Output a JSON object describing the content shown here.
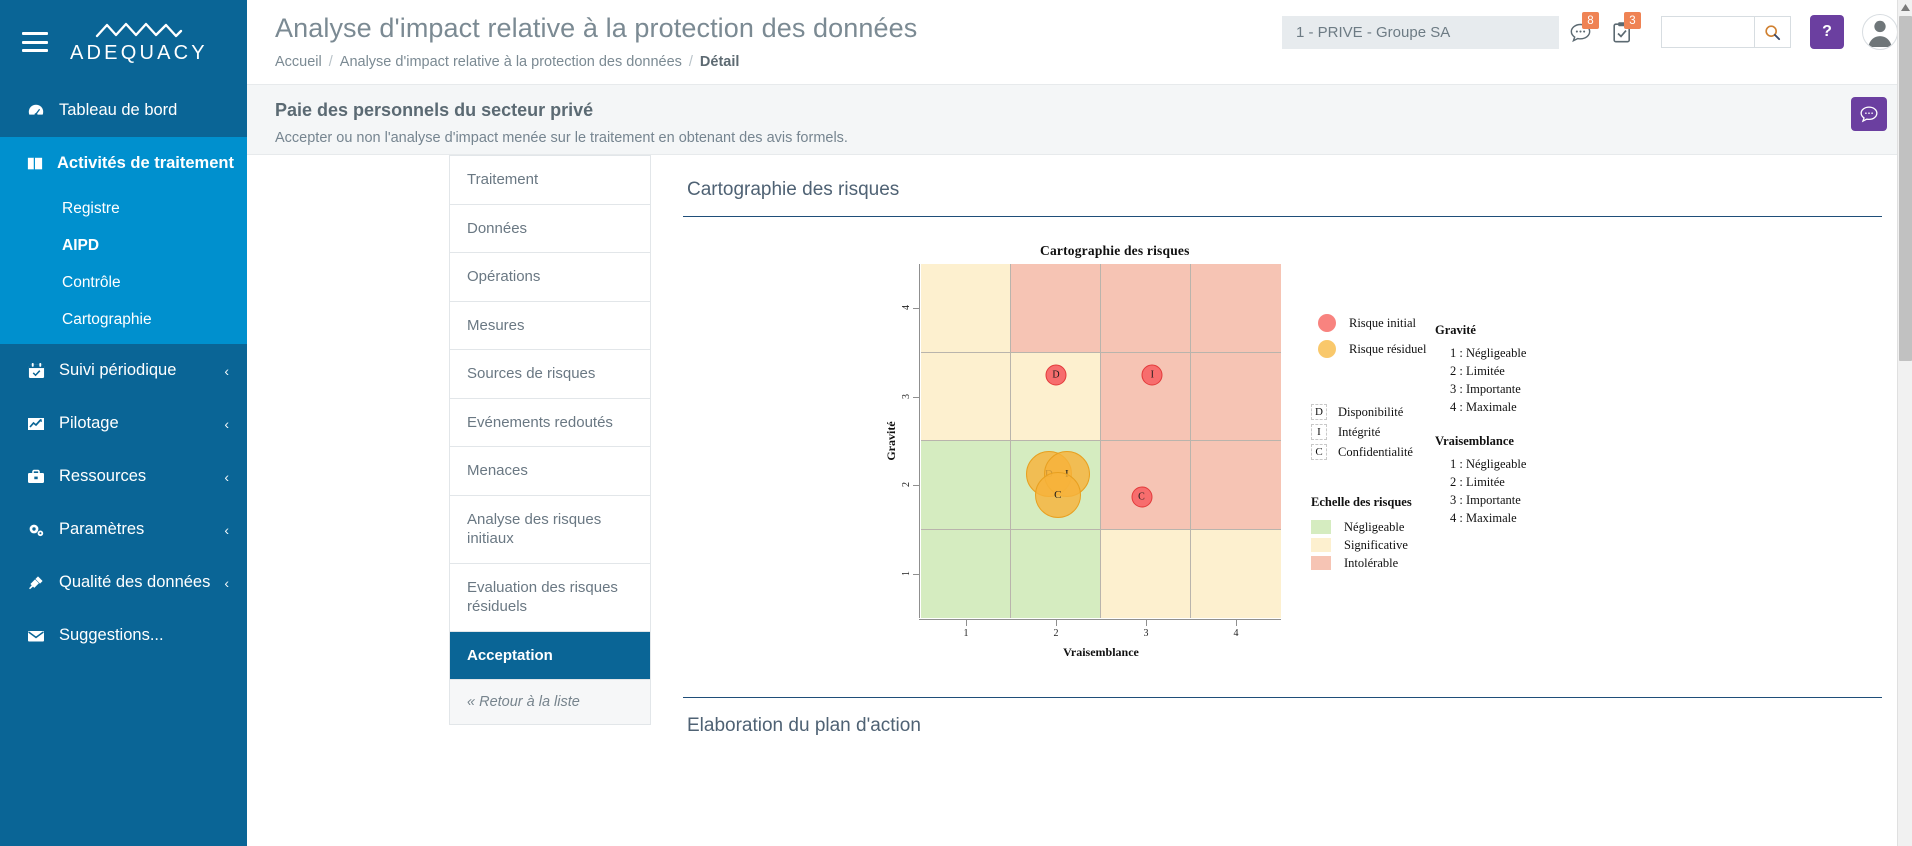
{
  "brand": {
    "name": "ADEQUACY",
    "logo_icon": "zigzag-logo-icon"
  },
  "sidebar": {
    "items": [
      {
        "label": "Tableau de bord",
        "icon": "dashboard-icon",
        "active": false,
        "chevron": ""
      },
      {
        "label": "Activités de traitement",
        "icon": "book-icon",
        "active": true,
        "chevron": ""
      },
      {
        "label": "Suivi périodique",
        "icon": "calendar-check-icon",
        "active": false,
        "chevron": "‹"
      },
      {
        "label": "Pilotage",
        "icon": "chart-line-icon",
        "active": false,
        "chevron": "‹"
      },
      {
        "label": "Ressources",
        "icon": "briefcase-icon",
        "active": false,
        "chevron": "‹"
      },
      {
        "label": "Paramètres",
        "icon": "gears-icon",
        "active": false,
        "chevron": "‹"
      },
      {
        "label": "Qualité des données",
        "icon": "plug-icon",
        "active": false,
        "chevron": "‹"
      },
      {
        "label": "Suggestions...",
        "icon": "envelope-icon",
        "active": false,
        "chevron": ""
      }
    ],
    "subitems": [
      {
        "label": "Registre",
        "active": false
      },
      {
        "label": "AIPD",
        "active": true
      },
      {
        "label": "Contrôle",
        "active": false
      },
      {
        "label": "Cartographie",
        "active": false
      }
    ]
  },
  "header": {
    "title": "Analyse d'impact relative à la protection des données",
    "breadcrumb": [
      {
        "label": "Accueil",
        "current": false
      },
      {
        "label": "Analyse d'impact relative à la protection des données",
        "current": false
      },
      {
        "label": "Détail",
        "current": true
      }
    ],
    "separator": "/",
    "context_select": "1 - PRIVE - Groupe SA",
    "messages_icon": "comment-dots-icon",
    "messages_badge": "8",
    "tasks_icon": "clipboard-check-icon",
    "tasks_badge": "3",
    "search_value": "",
    "search_placeholder": "",
    "search_icon": "search-icon",
    "help_label": "?",
    "avatar_icon": "user-avatar-icon"
  },
  "subheader": {
    "title": "Paie des personnels du secteur privé",
    "description": "Accepter ou non l'analyse d'impact menée sur le traitement en obtenant des avis formels.",
    "chat_icon": "comment-dots-icon"
  },
  "tabs": {
    "items": [
      {
        "label": "Traitement",
        "selected": false
      },
      {
        "label": "Données",
        "selected": false
      },
      {
        "label": "Opérations",
        "selected": false
      },
      {
        "label": "Mesures",
        "selected": false
      },
      {
        "label": "Sources de risques",
        "selected": false
      },
      {
        "label": "Evénements redoutés",
        "selected": false
      },
      {
        "label": "Menaces",
        "selected": false
      },
      {
        "label": "Analyse des risques initiaux",
        "selected": false
      },
      {
        "label": "Evaluation des risques résiduels",
        "selected": false
      },
      {
        "label": "Acceptation",
        "selected": true
      }
    ],
    "back_label": "« Retour à la liste"
  },
  "panels": {
    "cartographie_title": "Cartographie des risques",
    "plan_action_title": "Elaboration du plan d'action"
  },
  "chart_data": {
    "type": "scatter",
    "title": "Cartographie des risques",
    "xlabel": "Vraisemblance",
    "ylabel": "Gravité",
    "xticks": [
      "1",
      "2",
      "3",
      "4"
    ],
    "yticks": [
      "1",
      "2",
      "3",
      "4"
    ],
    "xlim": [
      0.5,
      4.5
    ],
    "ylim": [
      0.5,
      4.5
    ],
    "grid": true,
    "cells": [
      {
        "x": 1,
        "y": 4,
        "level": "Significative"
      },
      {
        "x": 2,
        "y": 4,
        "level": "Intolérable"
      },
      {
        "x": 3,
        "y": 4,
        "level": "Intolérable"
      },
      {
        "x": 4,
        "y": 4,
        "level": "Intolérable"
      },
      {
        "x": 1,
        "y": 3,
        "level": "Significative"
      },
      {
        "x": 2,
        "y": 3,
        "level": "Significative"
      },
      {
        "x": 3,
        "y": 3,
        "level": "Intolérable"
      },
      {
        "x": 4,
        "y": 3,
        "level": "Intolérable"
      },
      {
        "x": 1,
        "y": 2,
        "level": "Négligeable"
      },
      {
        "x": 2,
        "y": 2,
        "level": "Négligeable"
      },
      {
        "x": 3,
        "y": 2,
        "level": "Intolérable"
      },
      {
        "x": 4,
        "y": 2,
        "level": "Intolérable"
      },
      {
        "x": 1,
        "y": 1,
        "level": "Négligeable"
      },
      {
        "x": 2,
        "y": 1,
        "level": "Négligeable"
      },
      {
        "x": 3,
        "y": 1,
        "level": "Significative"
      },
      {
        "x": 4,
        "y": 1,
        "level": "Significative"
      }
    ],
    "series": [
      {
        "name": "Risque initial",
        "color": "#f76d6d",
        "points": [
          {
            "label": "D",
            "x": 2.0,
            "y": 3.25
          },
          {
            "label": "I",
            "x": 3.07,
            "y": 3.25
          },
          {
            "label": "C",
            "x": 2.95,
            "y": 1.87
          }
        ]
      },
      {
        "name": "Risque résiduel",
        "color": "#f6b23a",
        "points": [
          {
            "label": "D",
            "x": 1.92,
            "y": 2.13
          },
          {
            "label": "I",
            "x": 2.12,
            "y": 2.13
          },
          {
            "label": "C",
            "x": 2.02,
            "y": 1.89
          }
        ]
      }
    ],
    "legend_risk": [
      {
        "label": "Risque initial",
        "color": "#f76d6d"
      },
      {
        "label": "Risque résiduel",
        "color": "#f9c86b"
      }
    ],
    "legend_letters": [
      {
        "key": "D",
        "label": "Disponibilité"
      },
      {
        "key": "I",
        "label": "Intégrité"
      },
      {
        "key": "C",
        "label": "Confidentialité"
      }
    ],
    "legend_scale_title": "Echelle des risques",
    "legend_scale": [
      {
        "label": "Négligeable",
        "color": "#d5ecc0"
      },
      {
        "label": "Significative",
        "color": "#fdf0cf"
      },
      {
        "label": "Intolérable",
        "color": "#f6c4b4"
      }
    ],
    "scales": [
      {
        "title": "Gravité",
        "rows": [
          "1 : Négligeable",
          "2 : Limitée",
          "3 : Importante",
          "4 : Maximale"
        ]
      },
      {
        "title": "Vraisemblance",
        "rows": [
          "1 : Négligeable",
          "2 : Limitée",
          "3 : Importante",
          "4 : Maximale"
        ]
      }
    ]
  },
  "colors": {
    "sidebar_bg": "#0a6596",
    "sidebar_active": "#0090ce",
    "accent_purple": "#6b3fa0",
    "badge_orange": "#ef8354",
    "negligeable": "#d5ecc0",
    "significative": "#fdf0cf",
    "intolerable": "#f6c4b4"
  }
}
